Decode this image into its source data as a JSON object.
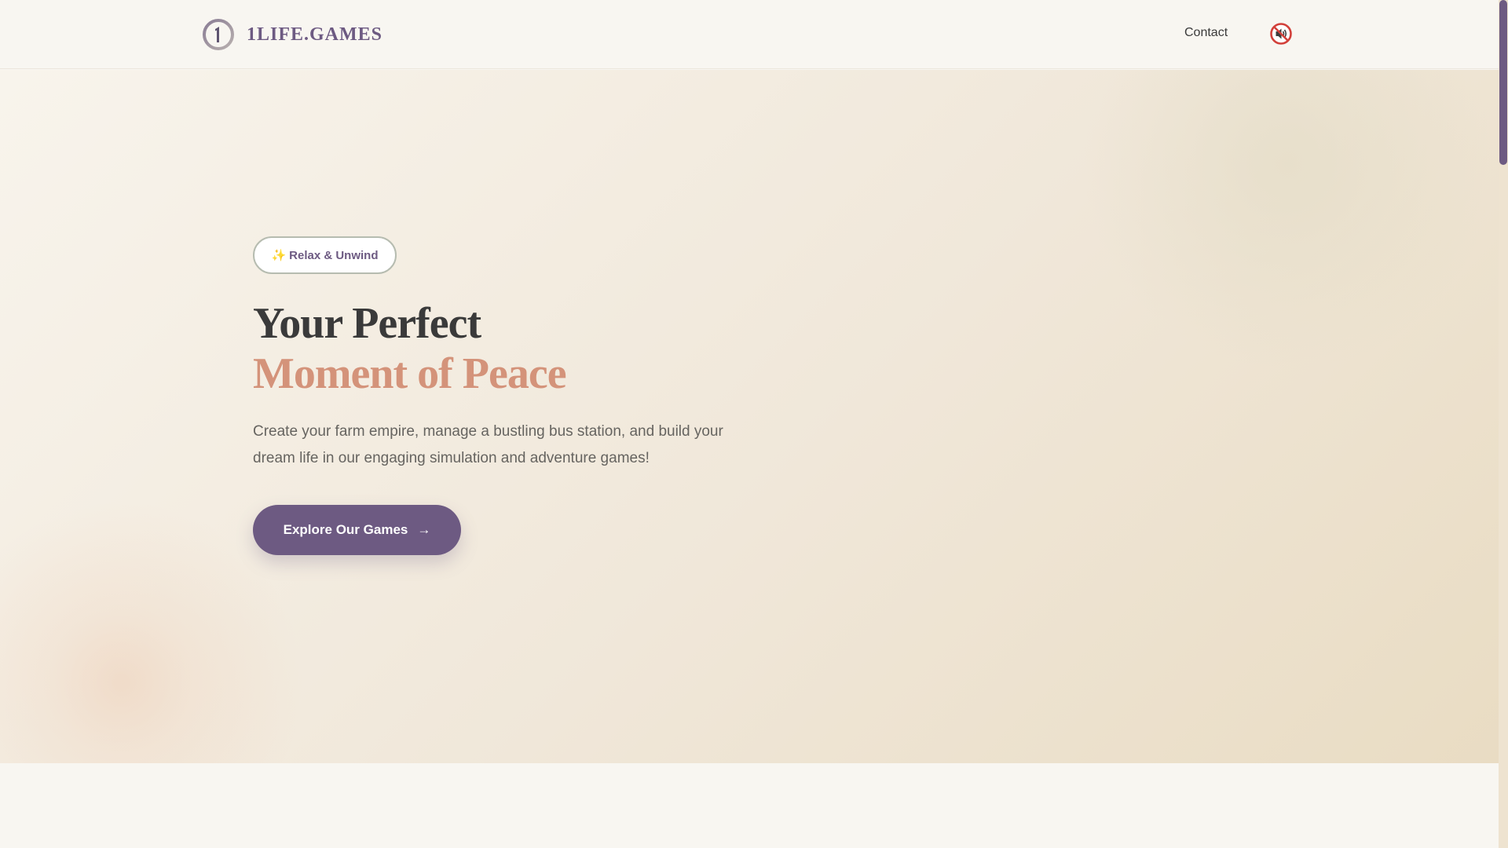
{
  "header": {
    "logo_text": "1LIFE.GAMES",
    "nav": {
      "contact_label": "Contact"
    },
    "sound_icon": "muted-speaker-icon"
  },
  "hero": {
    "badge_sparkle": "✨",
    "badge_label": "Relax & Unwind",
    "headline_line1": "Your Perfect",
    "headline_line2": "Moment of Peace",
    "description": "Create your farm empire, manage a bustling bus station, and build your dream life in our engaging simulation and adventure games!",
    "cta_label": "Explore Our Games",
    "cta_arrow": "→"
  },
  "colors": {
    "brand_purple": "#6d5a82",
    "accent_peach": "#d4937a",
    "text_dark": "#3a3a3a",
    "background": "#f8f6f1"
  }
}
